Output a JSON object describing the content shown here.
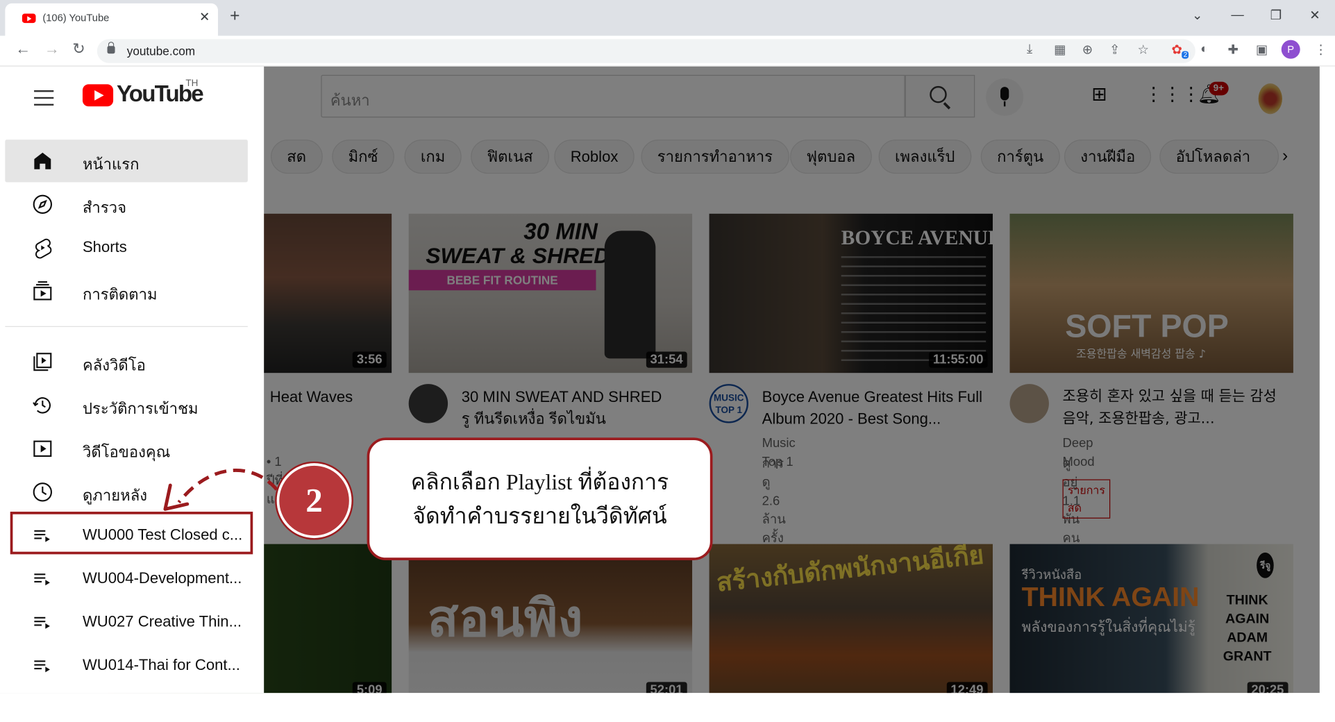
{
  "browser": {
    "tab_title": "(106) YouTube",
    "tab_close": "✕",
    "new_tab": "+",
    "url": "youtube.com",
    "ext_badge": "2",
    "profile_initial": "P",
    "window_controls": [
      "⌄",
      "—",
      "❐",
      "✕"
    ]
  },
  "masthead": {
    "logo_text": "YouTube",
    "country_code": "TH",
    "search_placeholder": "ค้นหา",
    "notification_count": "9+"
  },
  "chips": [
    "สด",
    "มิกซ์",
    "เกม",
    "ฟิตเนส",
    "Roblox",
    "รายการทำอาหาร",
    "ฟุตบอล",
    "เพลงแร็ป",
    "การ์ตูน",
    "งานฝีมือ",
    "อัปโหลดล่า"
  ],
  "sidebar": {
    "main": [
      {
        "label": "หน้าแรก",
        "icon": "home-icon"
      },
      {
        "label": "สำรวจ",
        "icon": "explore-icon"
      },
      {
        "label": "Shorts",
        "icon": "shorts-icon"
      },
      {
        "label": "การติดตาม",
        "icon": "subscriptions-icon"
      }
    ],
    "library": [
      {
        "label": "คลังวิดีโอ",
        "icon": "library-icon"
      },
      {
        "label": "ประวัติการเข้าชม",
        "icon": "history-icon"
      },
      {
        "label": "วิดีโอของคุณ",
        "icon": "your-videos-icon"
      },
      {
        "label": "ดูภายหลัง",
        "icon": "watch-later-icon"
      },
      {
        "label": "WU000 Test Closed c...",
        "icon": "playlist-icon"
      },
      {
        "label": "WU004-Development...",
        "icon": "playlist-icon"
      },
      {
        "label": "WU027 Creative Thin...",
        "icon": "playlist-icon"
      },
      {
        "label": "WU014-Thai for Cont...",
        "icon": "playlist-icon"
      }
    ]
  },
  "videos": [
    {
      "title": "Heat Waves",
      "meta": "• 1 ปีที่แล้ว",
      "duration": "3:56"
    },
    {
      "title": "30 MIN SWEAT AND SHRED รู ทีนรีดเหงื่อ รีดไขมัน",
      "duration": "31:54",
      "thumb_line1": "30 MIN",
      "thumb_line2": "SWEAT & SHRED",
      "thumb_line3": "BEBE FIT ROUTINE"
    },
    {
      "title": "Boyce Avenue Greatest Hits Full Album 2020 - Best Song...",
      "channel": "Music Top 1",
      "meta": "การดู 2.6 ล้าน ครั้ง • 1 ปีที่แล้ว",
      "duration": "11:55:00",
      "thumb_text": "BOYCE AVENUE",
      "channel_logo": "MUSIC TOP 1"
    },
    {
      "title": "조용히 혼자 있고 싶을 때 듣는 감성음악, 조용한팝송, 광고...",
      "channel": "Deep Mood",
      "meta": "ดูอยู่ 1.1 พัน คน",
      "badge": "รายการสด",
      "thumb_text": "SOFT POP",
      "thumb_sub": "조용한팝송 새벽감성 팝송 ♪"
    },
    {
      "duration": "5:09"
    },
    {
      "duration": "52:01",
      "thumb_text": "สอนพิง"
    },
    {
      "duration": "12:49",
      "thumb_text": "สร้างกับดักพนักงานอีเกีย"
    },
    {
      "duration": "20:25",
      "thumb_line1": "รีวิวหนังสือ",
      "thumb_line2": "THINK AGAIN",
      "thumb_line3": "พลังของการรู้ในสิ่งที่คุณไม่รู้",
      "badge_tr": "รีจู",
      "book": "THINK AGAIN ADAM GRANT"
    }
  ],
  "annotation": {
    "step": "2",
    "line1": "คลิกเลือก Playlist ที่ต้องการ",
    "line2": "จัดทำคำบรรยายในวีดิทัศน์"
  },
  "colors": {
    "accent": "#9b1b1e",
    "yt_red": "#ff0000",
    "dim": "rgba(0,0,0,0.5)"
  }
}
